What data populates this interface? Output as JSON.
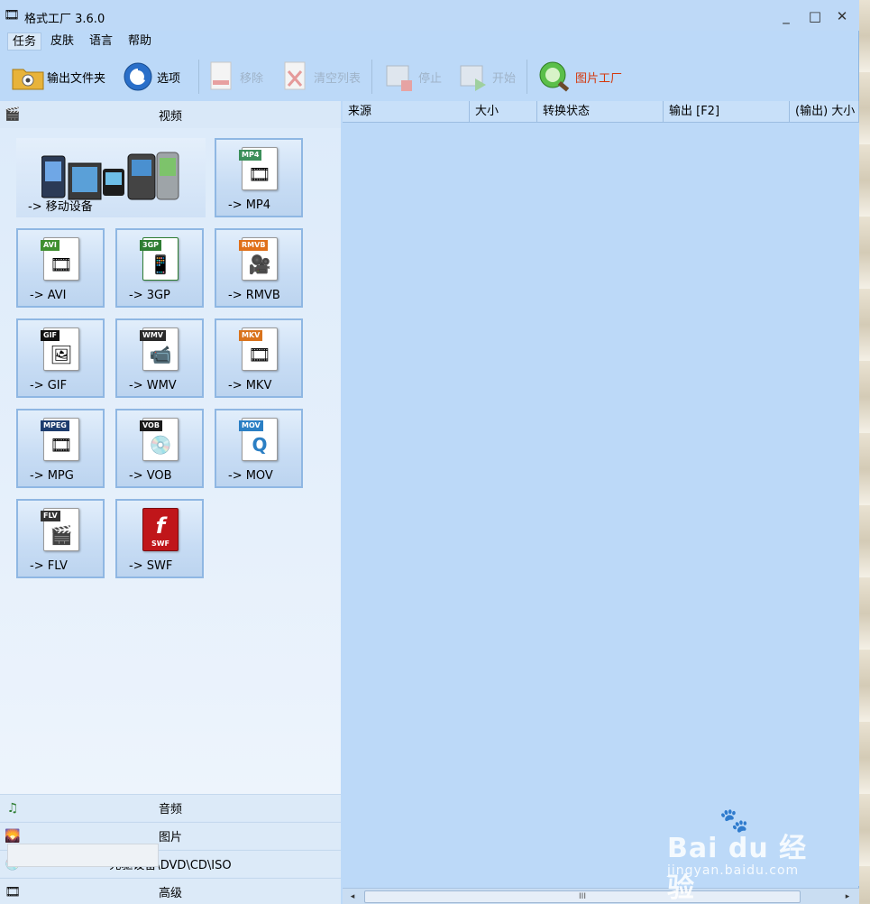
{
  "window": {
    "title": "格式工厂 3.6.0",
    "controls": {
      "minimize": "_",
      "maximize": "□",
      "close": "✕"
    }
  },
  "menu": [
    "任务",
    "皮肤",
    "语言",
    "帮助"
  ],
  "toolbar": {
    "output_folder": "输出文件夹",
    "options": "选项",
    "remove": "移除",
    "clear_list": "清空列表",
    "stop": "停止",
    "start": "开始",
    "picture_factory": "图片工厂"
  },
  "categories": {
    "video": "视频",
    "audio": "音频",
    "picture": "图片",
    "rom": "光驱设备\\DVD\\CD\\ISO",
    "advanced": "高级"
  },
  "video_tiles": [
    {
      "label": "-> 移动设备",
      "tag": "",
      "tag_color": ""
    },
    {
      "label": "-> MP4",
      "tag": "MP4",
      "tag_color": "#3c8f5a"
    },
    {
      "label": "-> AVI",
      "tag": "AVI",
      "tag_color": "#3f8f2f"
    },
    {
      "label": "-> 3GP",
      "tag": "3GP",
      "tag_color": "#2e7d32"
    },
    {
      "label": "-> RMVB",
      "tag": "RMVB",
      "tag_color": "#e0701a"
    },
    {
      "label": "-> GIF",
      "tag": "GIF",
      "tag_color": "#111111"
    },
    {
      "label": "-> WMV",
      "tag": "WMV",
      "tag_color": "#2a2a2a"
    },
    {
      "label": "-> MKV",
      "tag": "MKV",
      "tag_color": "#d9731c"
    },
    {
      "label": "-> MPG",
      "tag": "MPEG",
      "tag_color": "#1d3c6e"
    },
    {
      "label": "-> VOB",
      "tag": "VOB",
      "tag_color": "#1b1b1b"
    },
    {
      "label": "-> MOV",
      "tag": "MOV",
      "tag_color": "#2b7fc4"
    },
    {
      "label": "-> FLV",
      "tag": "FLV",
      "tag_color": "#333333"
    },
    {
      "label": "-> SWF",
      "tag": "SWF",
      "tag_color": "#c0161a"
    }
  ],
  "table_columns": [
    "来源",
    "大小",
    "转换状态",
    "输出 [F2]",
    "(输出) 大小"
  ],
  "scrollbar": {
    "left": "◂",
    "right": "▸",
    "grip": "III"
  },
  "watermark": {
    "logo": "Bai du 经验",
    "url": "jingyan.baidu.com"
  },
  "colors": {
    "window_bg": "#bcd9f8",
    "tile_border": "#8fb7e3",
    "highlight_text": "#d4380d"
  }
}
